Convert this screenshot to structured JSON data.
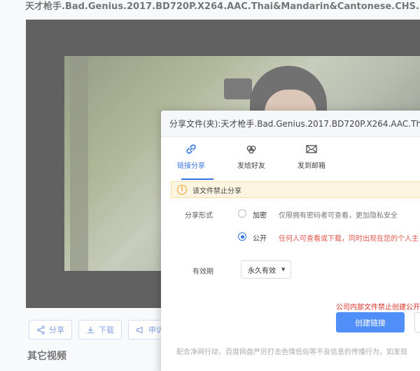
{
  "page": {
    "title": "天才枪手.Bad.Genius.2017.BD720P.X264.AAC.Thai&Mandarin&Cantonese.CHS.MF",
    "actions": [
      {
        "label": "分享",
        "icon": "share-icon"
      },
      {
        "label": "下载",
        "icon": "download-icon"
      },
      {
        "label": "申诉",
        "icon": "megaphone-icon"
      }
    ],
    "other_videos_heading": "其它视频"
  },
  "dialog": {
    "title": "分享文件(夹):天才枪手.Bad.Genius.2017.BD720P.X264.AAC.Thai&M",
    "tabs": [
      {
        "label": "链接分享",
        "icon": "link-icon",
        "active": true
      },
      {
        "label": "发给好友",
        "icon": "friends-icon",
        "active": false
      },
      {
        "label": "发到邮箱",
        "icon": "mail-icon",
        "active": false
      }
    ],
    "warning": "该文件禁止分享",
    "share_form": {
      "label": "分享形式",
      "options": [
        {
          "name": "加密",
          "desc": "仅限拥有密码者可查看，更加隐私安全",
          "selected": false
        },
        {
          "name": "公开",
          "desc": "任何人可查看或下载，同时出现在您的个人主",
          "selected": true
        }
      ]
    },
    "validity": {
      "label": "有效期",
      "value": "永久有效"
    },
    "red_note": "公司内部文件禁止创建公开",
    "create_button": "创建链接",
    "footer_note": "配合净网行动，百度网盘严厉打击色情低俗等不良信息的传播行为，如发现"
  },
  "colors": {
    "accent": "#3574e5",
    "primary_button": "#4f8ff7",
    "warning_bg": "#fdf5e1",
    "danger_text": "#d93025"
  }
}
